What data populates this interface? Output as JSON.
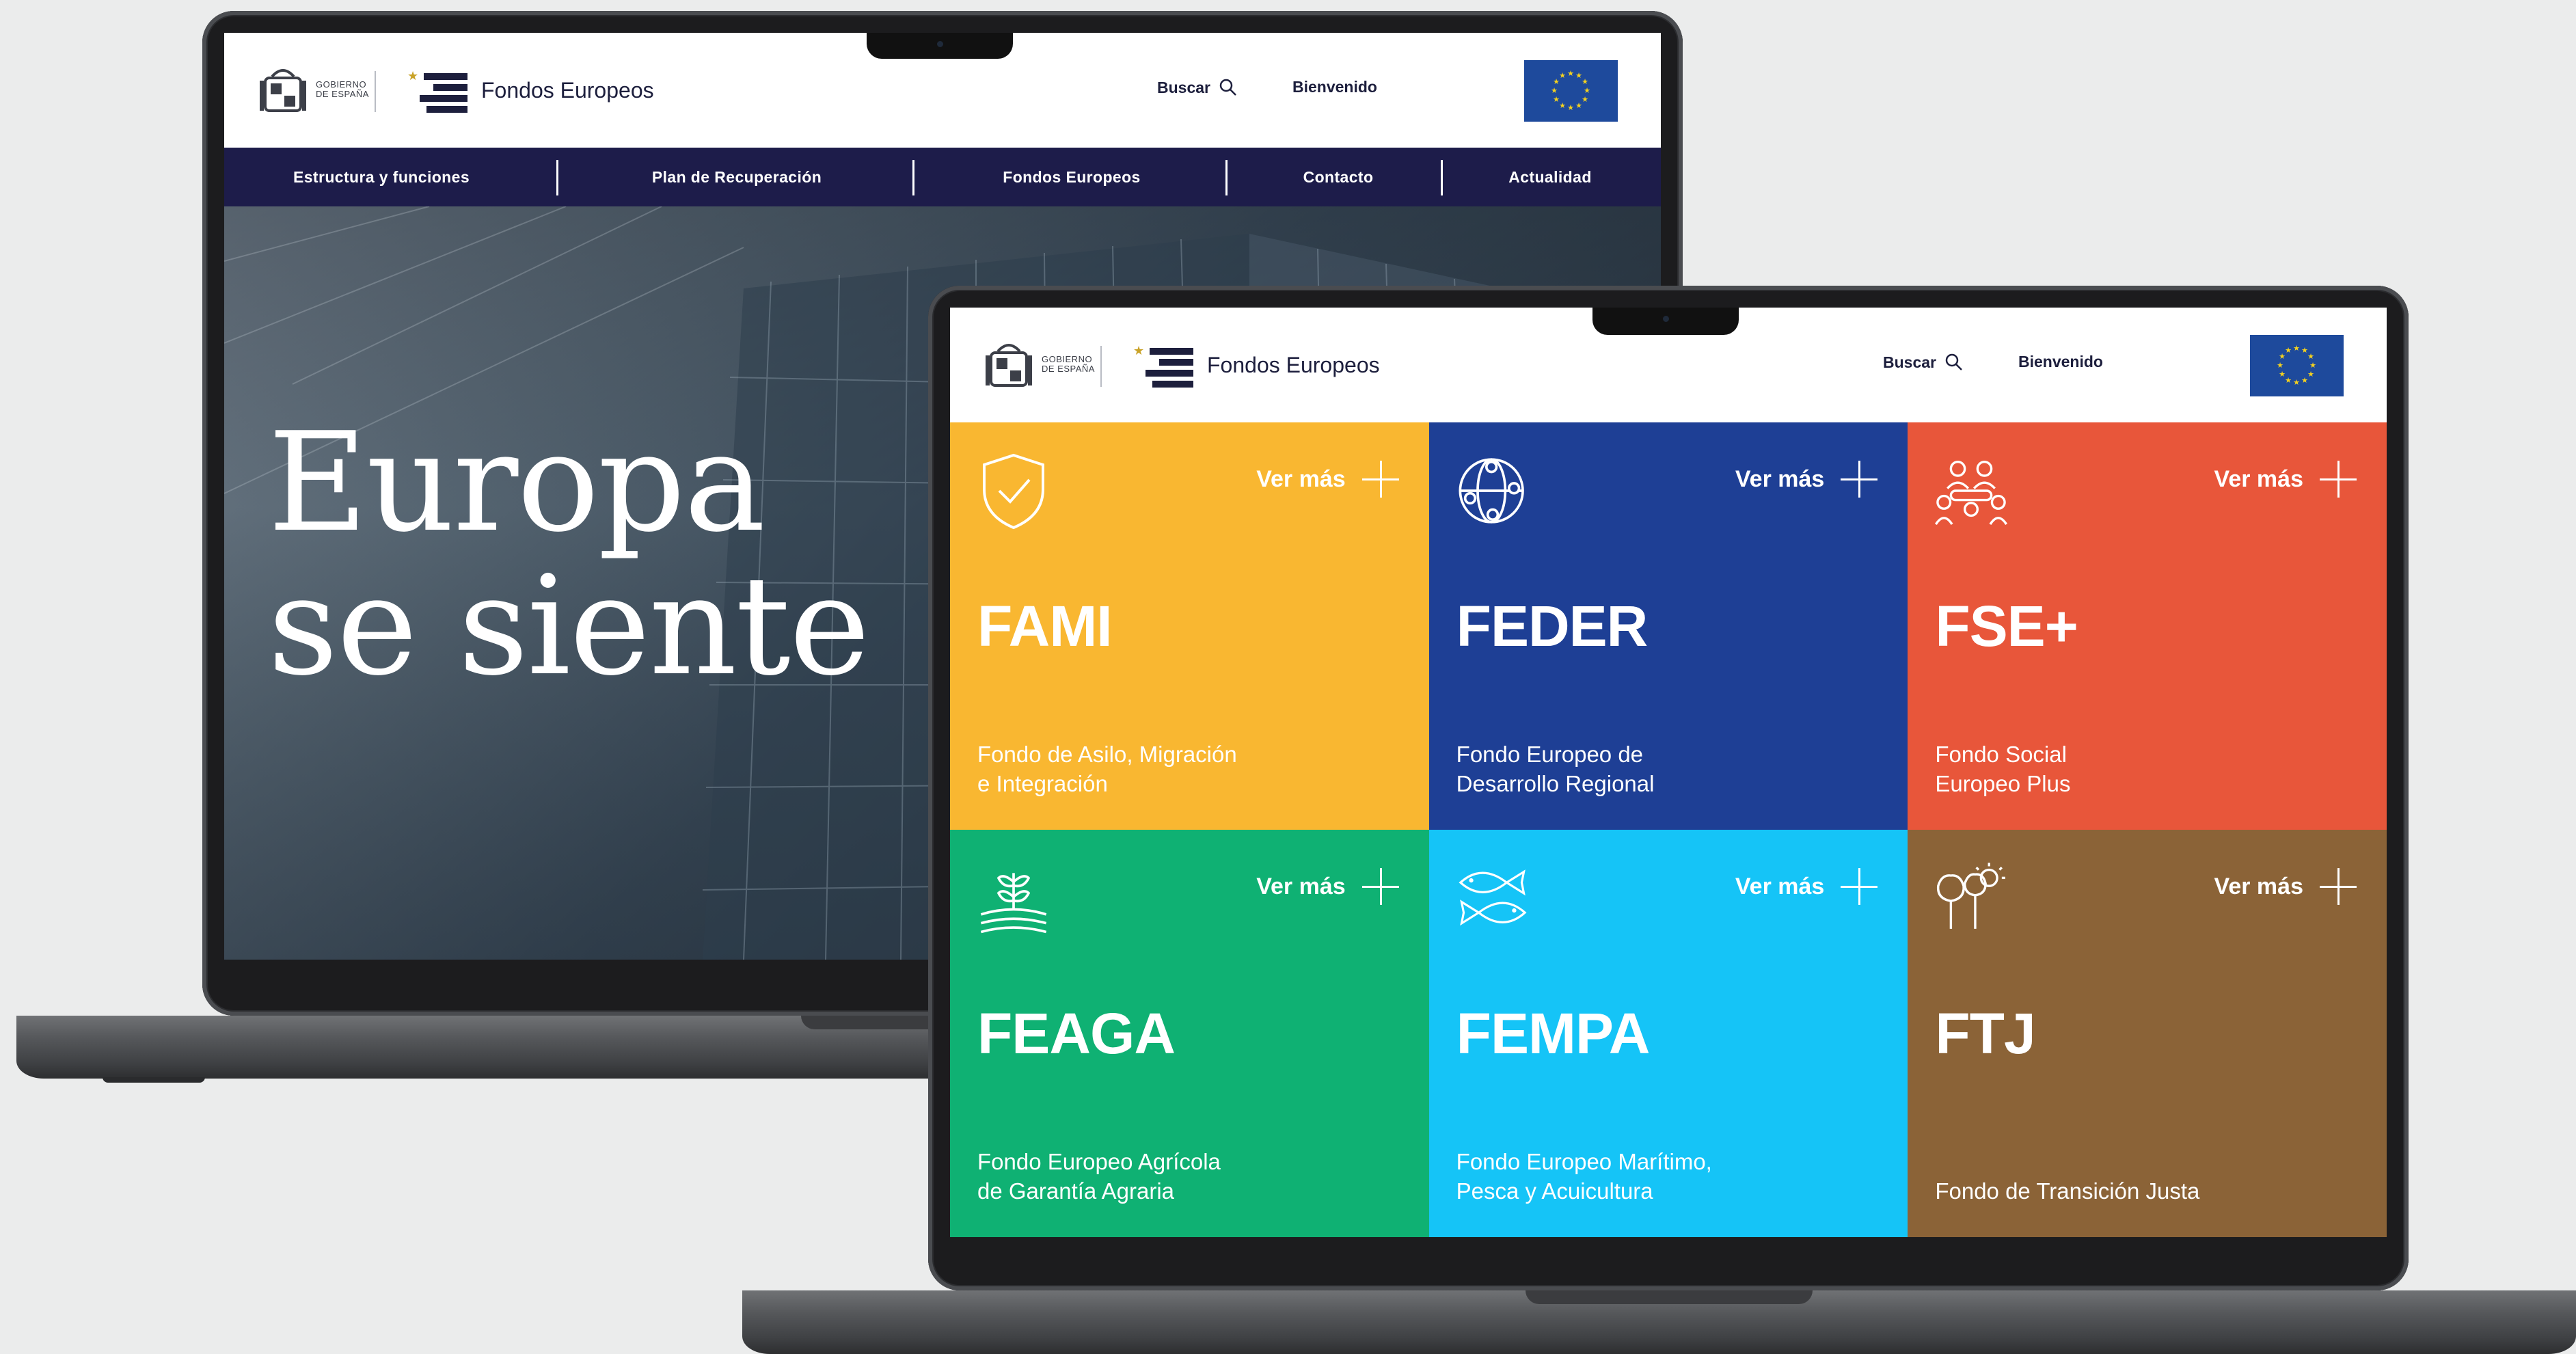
{
  "site": {
    "gov_line1": "GOBIERNO",
    "gov_line2": "DE ESPAÑA",
    "title": "Fondos Europeos",
    "search_label": "Buscar",
    "welcome_label": "Bienvenido"
  },
  "nav": [
    {
      "label": "Estructura y funciones"
    },
    {
      "label": "Plan de Recuperación"
    },
    {
      "label": "Fondos Europeos"
    },
    {
      "label": "Contacto"
    },
    {
      "label": "Actualidad"
    }
  ],
  "hero": {
    "line1": "Europa",
    "line2": "se siente"
  },
  "funds": [
    {
      "code": "FAMI",
      "name_line1": "Fondo de Asilo, Migración",
      "name_line2": "e Integración",
      "more": "Ver más",
      "color": "#f9b731",
      "icon": "shield-check-icon"
    },
    {
      "code": "FEDER",
      "name_line1": "Fondo Europeo de",
      "name_line2": "Desarrollo Regional",
      "more": "Ver más",
      "color": "#1e3f95",
      "icon": "globe-network-icon"
    },
    {
      "code": "FSE+",
      "name_line1": "Fondo Social",
      "name_line2": "Europeo Plus",
      "more": "Ver más",
      "color": "#e8563a",
      "icon": "people-meeting-icon"
    },
    {
      "code": "FEAGA",
      "name_line1": "Fondo Europeo Agrícola",
      "name_line2": "de Garantía Agraria",
      "more": "Ver más",
      "color": "#0fb173",
      "icon": "sprout-field-icon"
    },
    {
      "code": "FEMPA",
      "name_line1": "Fondo Europeo Marítimo,",
      "name_line2": "Pesca y Acuicultura",
      "more": "Ver más",
      "color": "#15c4f7",
      "icon": "fish-icon"
    },
    {
      "code": "FTJ",
      "name_line1": "Fondo de Transición Justa",
      "name_line2": "",
      "more": "Ver más",
      "color": "#8b6337",
      "icon": "trees-sun-icon"
    }
  ]
}
